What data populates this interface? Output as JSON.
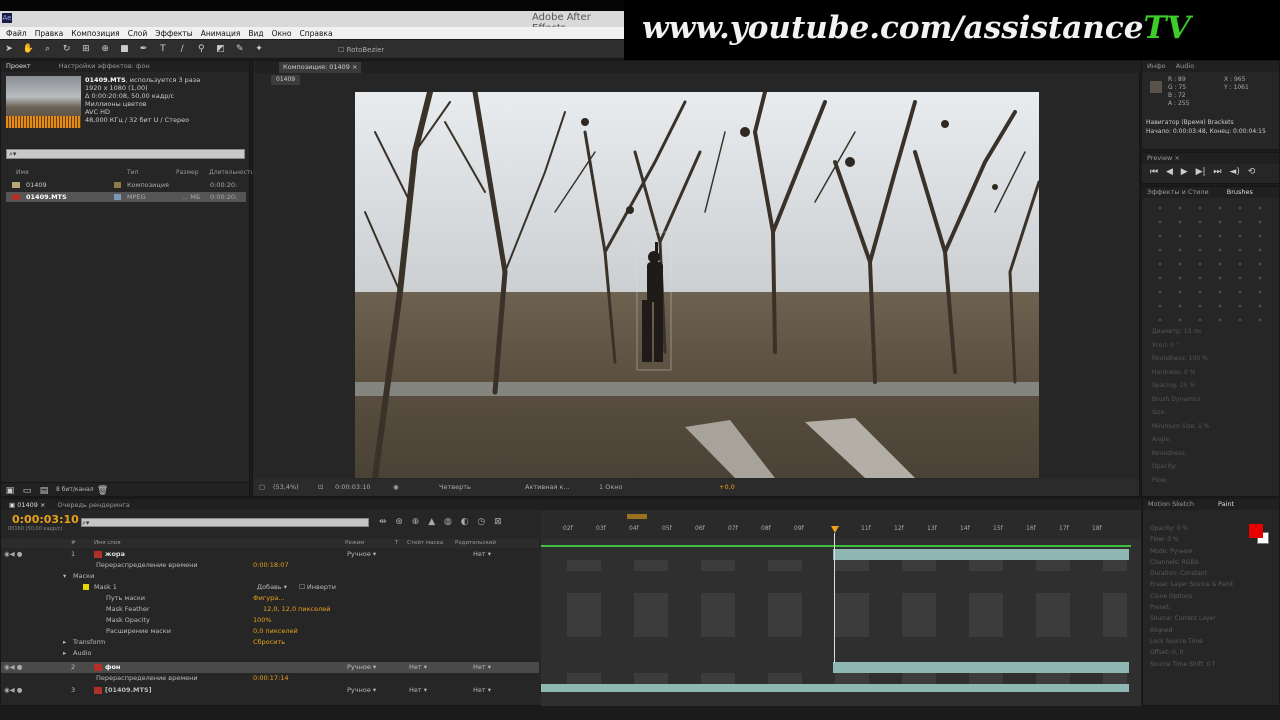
{
  "window": {
    "title": "Adobe After Effects"
  },
  "watermark": {
    "prefix": "www.youtube.com/assistance",
    "suffix": "TV"
  },
  "menu": [
    "Файл",
    "Правка",
    "Композиция",
    "Слой",
    "Эффекты",
    "Анимация",
    "Вид",
    "Окно",
    "Справка"
  ],
  "toolbar": {
    "rotobezier": "RotoBezier"
  },
  "project_panel": {
    "tabs": [
      "Проект",
      "Настройки эффектов: фон"
    ],
    "info": {
      "name": "01409.MTS",
      "used": ", используется 3 раза",
      "resolution": "1920 x 1080 (1,00)",
      "duration": "Δ 0:00:20:08, 50,00 кадр/с",
      "colors": "Миллионы цветов",
      "codec": "AVC HD",
      "audio": "48,000 КГц / 32 бит U / Стерео"
    },
    "columns": [
      "Имя",
      "Тип",
      "Размер",
      "Длительность"
    ],
    "items": [
      {
        "name": "01409",
        "type": "Композиция",
        "size": "",
        "duration": "0:00:20:",
        "selected": false
      },
      {
        "name": "01409.MTS",
        "type": "MPEG",
        "size": "... МБ",
        "duration": "0:00:20:",
        "selected": true
      }
    ],
    "depth": "8 бит/канал"
  },
  "comp_panel": {
    "tab": "Композиция: 01409",
    "subtab": "01409",
    "controls": {
      "zoom": "(53,4%)",
      "timecode": "0:00:03:10",
      "resolution": "Четверть",
      "camera": "Активная к...",
      "views": "1 Окно",
      "exposure": "+0,0"
    }
  },
  "info_panel": {
    "tabs": [
      "Инфо",
      "Audio"
    ],
    "r": "R : 89",
    "g": "G : 75",
    "b": "B : 72",
    "a": "A : 255",
    "x": "X : 965",
    "y": "Y : 1061",
    "nav": "Навигатор (Время) Brackets",
    "range": "Начало: 0:00:03:48, Конец: 0:00:04:15"
  },
  "preview_panel": {
    "tab": "Preview"
  },
  "brushes_panel": {
    "tabs": [
      "Эффекты и Стили",
      "Brushes"
    ],
    "props": [
      "Диаметр: 13 пи",
      "Угол: 0 °",
      "Roundness: 100 %",
      "Hardness: 0 %",
      "Spacing: 25 %",
      "Brush Dynamics",
      "Size:",
      "Minimum Size: 1 %",
      "Angle:",
      "Roundness:",
      "Opacity:",
      "Flow:"
    ]
  },
  "timeline": {
    "tabs": [
      "01409",
      "Очередь рендеринга"
    ],
    "timecode": "0:00:03:10",
    "fps": "00160 (50,00 кадр/с)",
    "columns": [
      "#",
      "Имя слоя",
      "Режим",
      "T",
      "Стейт маска",
      "Родительский"
    ],
    "layers": [
      {
        "num": "1",
        "name": "жора",
        "mode": "Ручное",
        "parent": "Нет"
      },
      {
        "prop": "Перераспределение времени",
        "value": "0:00:18:07"
      },
      {
        "prop": "Маски"
      },
      {
        "prop": "Mask 1",
        "mode": "Добавь",
        "invert": "Инверти"
      },
      {
        "prop": "Путь маски",
        "value": "Фигура..."
      },
      {
        "prop": "Mask Feather",
        "value": "12,0, 12,0 пикселей"
      },
      {
        "prop": "Mask Opacity",
        "value": "100%"
      },
      {
        "prop": "Расширение маски",
        "value": "0,0 пикселей"
      },
      {
        "prop": "Transform",
        "value": "Сбросить"
      },
      {
        "prop": "Audio"
      },
      {
        "num": "2",
        "name": "фон",
        "mode": "Ручное",
        "trkmat": "Нет",
        "parent": "Нет"
      },
      {
        "prop": "Перераспределение времени",
        "value": "0:00:17:14"
      },
      {
        "num": "3",
        "name": "[01409.MTS]",
        "mode": "Ручное",
        "trkmat": "Нет",
        "parent": "Нет"
      }
    ],
    "ruler": [
      "02f",
      "03f",
      "04f",
      "05f",
      "06f",
      "07f",
      "08f",
      "09f",
      "",
      "11f",
      "12f",
      "13f",
      "14f",
      "15f",
      "16f",
      "17f",
      "18f"
    ]
  },
  "paint_panel": {
    "tabs": [
      "Motion Sketch",
      "Paint"
    ],
    "props": [
      "Opacity: 0 %",
      "Flow: 0 %",
      "Mode: Ручное",
      "Channels: RGBA",
      "Duration: Constant",
      "Erase: Layer Source & Paint",
      "Clone Options",
      "Preset:",
      "Source: Current Layer",
      "Aligned",
      "Lock Source Time",
      "Offset: 0, 0",
      "Source Time Shift: 0 f"
    ],
    "color_fg": "#e60000",
    "color_bg": "#ffffff"
  },
  "colors": {
    "accent": "#e8a21a",
    "watermark_green": "#3ccd2a",
    "layer_bar": "#8fb8b4"
  }
}
